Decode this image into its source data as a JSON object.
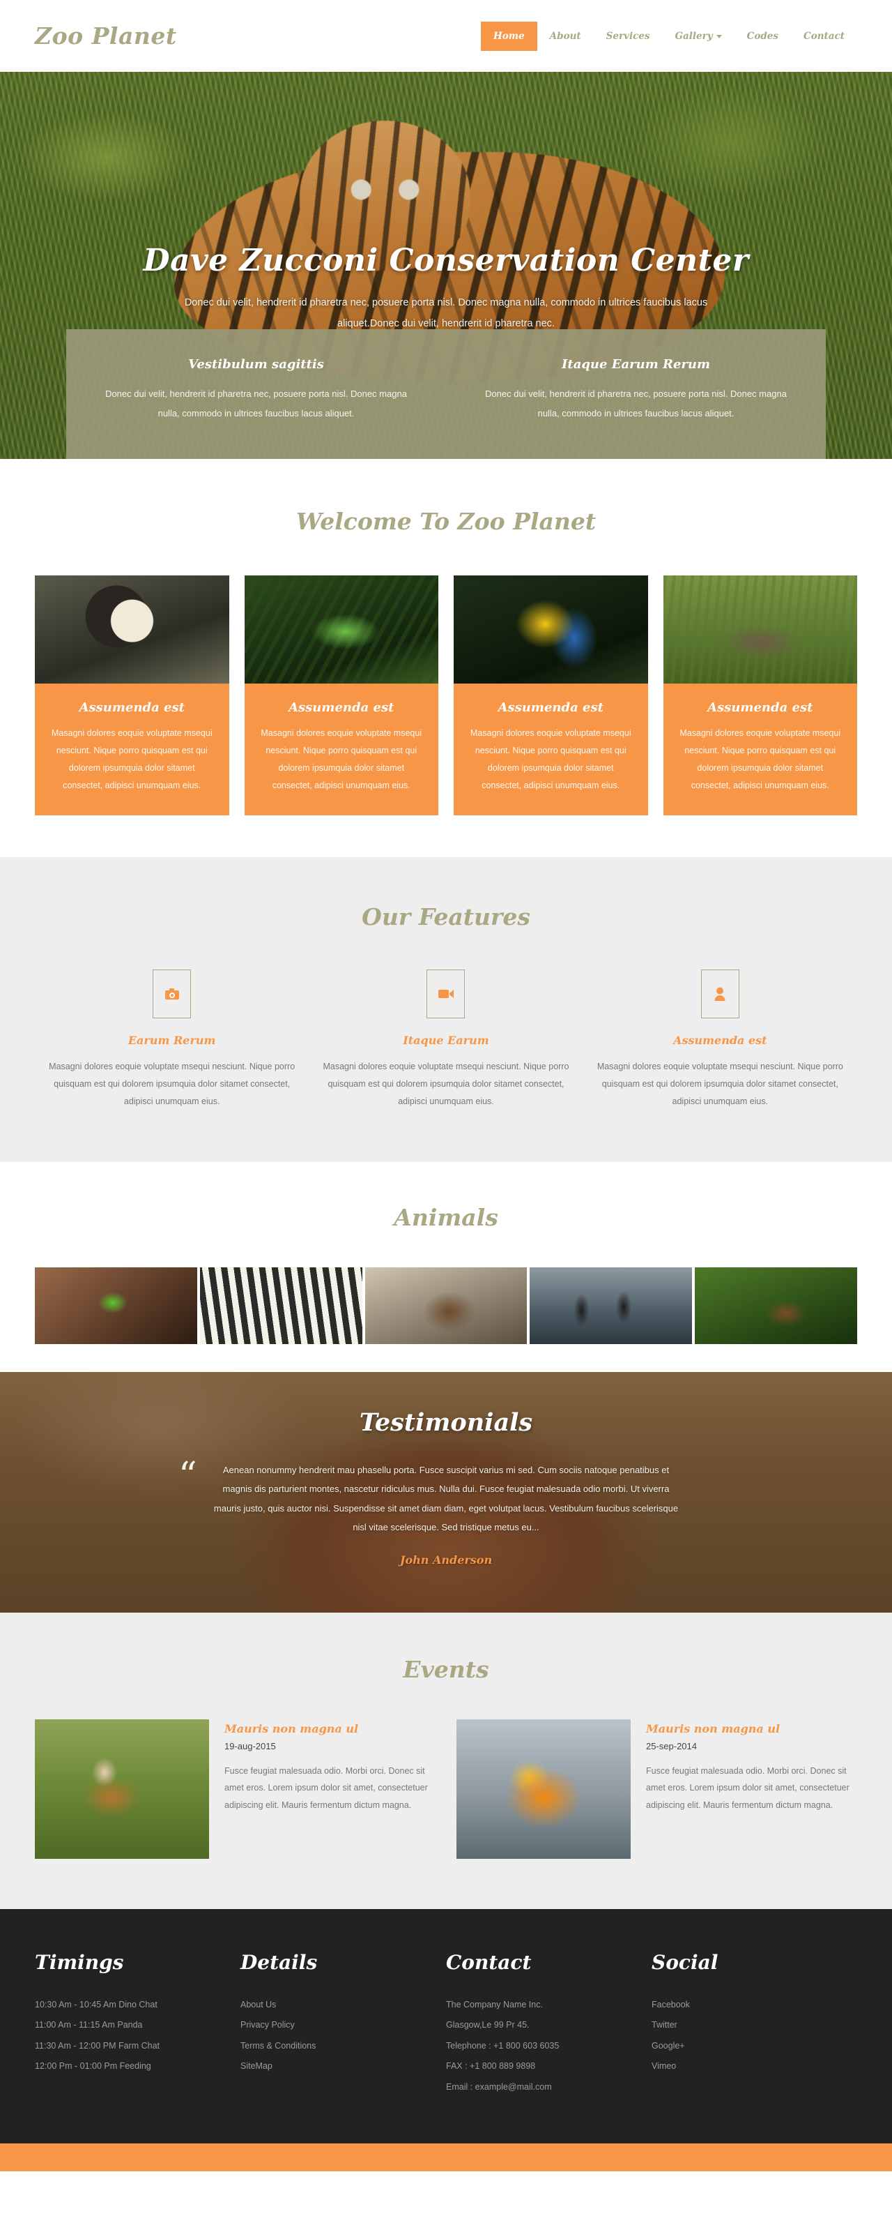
{
  "header": {
    "logo": "Zoo Planet",
    "nav": [
      {
        "label": "Home",
        "active": true,
        "dropdown": false
      },
      {
        "label": "About",
        "active": false,
        "dropdown": false
      },
      {
        "label": "Services",
        "active": false,
        "dropdown": false
      },
      {
        "label": "Gallery",
        "active": false,
        "dropdown": true
      },
      {
        "label": "Codes",
        "active": false,
        "dropdown": false
      },
      {
        "label": "Contact",
        "active": false,
        "dropdown": false
      }
    ]
  },
  "hero": {
    "title": "Dave Zucconi Conservation Center",
    "subtitle": "Donec dui velit, hendrerit id pharetra nec, posuere porta nisl. Donec magna nulla, commodo in ultrices faucibus lacus aliquet.Donec dui velit, hendrerit id pharetra nec.",
    "banners": [
      {
        "title": "Vestibulum sagittis",
        "text": "Donec dui velit, hendrerit id pharetra nec, posuere porta nisl. Donec magna nulla, commodo in ultrices faucibus lacus aliquet."
      },
      {
        "title": "Itaque Earum Rerum",
        "text": "Donec dui velit, hendrerit id pharetra nec, posuere porta nisl. Donec magna nulla, commodo in ultrices faucibus lacus aliquet."
      }
    ]
  },
  "welcome": {
    "title": "Welcome To Zoo Planet",
    "cards": [
      {
        "image_name": "colobus-monkey-photo",
        "title": "Assumenda est",
        "text": "Masagni dolores eoquie voluptate msequi nesciunt. Nique porro quisquam est qui dolorem ipsumquia dolor sitamet consectet, adipisci unumquam eius."
      },
      {
        "image_name": "green-iguana-photo",
        "title": "Assumenda est",
        "text": "Masagni dolores eoquie voluptate msequi nesciunt. Nique porro quisquam est qui dolorem ipsumquia dolor sitamet consectet, adipisci unumquam eius."
      },
      {
        "image_name": "blue-macaw-photo",
        "title": "Assumenda est",
        "text": "Masagni dolores eoquie voluptate msequi nesciunt. Nique porro quisquam est qui dolorem ipsumquia dolor sitamet consectet, adipisci unumquam eius."
      },
      {
        "image_name": "tapir-photo",
        "title": "Assumenda est",
        "text": "Masagni dolores eoquie voluptate msequi nesciunt. Nique porro quisquam est qui dolorem ipsumquia dolor sitamet consectet, adipisci unumquam eius."
      }
    ]
  },
  "features": {
    "title": "Our Features",
    "items": [
      {
        "icon": "camera-icon",
        "title": "Earum Rerum",
        "text": "Masagni dolores eoquie voluptate msequi nesciunt. Nique porro quisquam est qui dolorem ipsumquia dolor sitamet consectet, adipisci unumquam eius."
      },
      {
        "icon": "video-camera-icon",
        "title": "Itaque Earum",
        "text": "Masagni dolores eoquie voluptate msequi nesciunt. Nique porro quisquam est qui dolorem ipsumquia dolor sitamet consectet, adipisci unumquam eius."
      },
      {
        "icon": "user-icon",
        "title": "Assumenda est",
        "text": "Masagni dolores eoquie voluptate msequi nesciunt. Nique porro quisquam est qui dolorem ipsumquia dolor sitamet consectet, adipisci unumquam eius."
      }
    ]
  },
  "animals": {
    "title": "Animals",
    "thumbnails": [
      "red-eyed-tree-frog-photo",
      "zebra-photo",
      "brown-bear-photo",
      "penguins-photo",
      "deer-photo"
    ]
  },
  "testimonials": {
    "title": "Testimonials",
    "quote_mark": "“",
    "quote": "Aenean nonummy hendrerit mau phasellu porta. Fusce suscipit varius mi sed. Cum sociis natoque penatibus et magnis dis parturient montes, nascetur ridiculus mus. Nulla dui. Fusce feugiat malesuada odio morbi. Ut viverra mauris justo, quis auctor nisi. Suspendisse sit amet diam diam, eget volutpat lacus. Vestibulum faucibus scelerisque nisl vitae scelerisque. Sed tristique metus eu...",
    "author": "John Anderson"
  },
  "events": {
    "title": "Events",
    "items": [
      {
        "image_name": "woman-with-dog-photo",
        "title": "Mauris non magna ul",
        "date": "19-aug-2015",
        "text": "Fusce feugiat malesuada odio. Morbi orci. Donec sit amet eros. Lorem ipsum dolor sit amet, consectetuer adipiscing elit. Mauris fermentum dictum magna."
      },
      {
        "image_name": "sun-conure-parrot-photo",
        "title": "Mauris non magna ul",
        "date": "25-sep-2014",
        "text": "Fusce feugiat malesuada odio. Morbi orci. Donec sit amet eros. Lorem ipsum dolor sit amet, consectetuer adipiscing elit. Mauris fermentum dictum magna."
      }
    ]
  },
  "footer": {
    "timings": {
      "title": "Timings",
      "items": [
        "10:30 Am - 10:45 Am Dino Chat",
        "11:00 Am - 11:15 Am Panda",
        "11:30 Am - 12:00 PM Farm Chat",
        "12:00 Pm - 01:00 Pm Feeding"
      ]
    },
    "details": {
      "title": "Details",
      "items": [
        "About Us",
        "Privacy Policy",
        "Terms & Conditions",
        "SiteMap"
      ]
    },
    "contact": {
      "title": "Contact",
      "items": [
        "The Company Name Inc.",
        "Glasgow,Le 99 Pr 45.",
        "Telephone : +1 800 603 6035",
        "FAX : +1 800 889 9898",
        "Email : example@mail.com"
      ]
    },
    "social": {
      "title": "Social",
      "items": [
        "Facebook",
        "Twitter",
        "Google+",
        "Vimeo"
      ]
    }
  },
  "colors": {
    "accent_orange": "#f79646",
    "olive": "#a9a883",
    "footer_dark": "#222222",
    "light_grey": "#eeeeee"
  }
}
